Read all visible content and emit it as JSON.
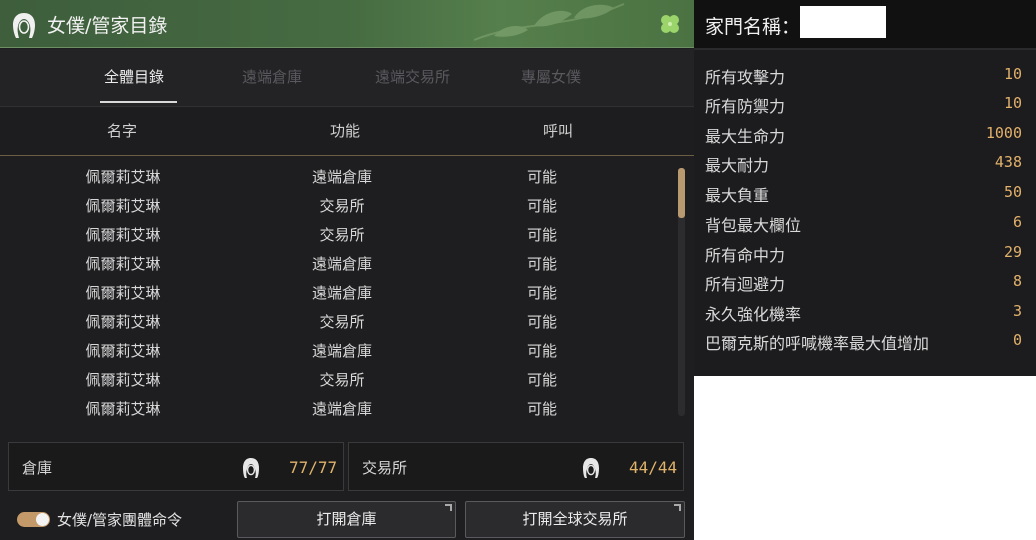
{
  "window": {
    "title": "女僕/管家目錄"
  },
  "tabs": [
    {
      "label": "全體目錄",
      "active": true
    },
    {
      "label": "遠端倉庫",
      "active": false
    },
    {
      "label": "遠端交易所",
      "active": false
    },
    {
      "label": "專屬女僕",
      "active": false
    }
  ],
  "table": {
    "headers": [
      "名字",
      "功能",
      "呼叫"
    ],
    "rows": [
      [
        "佩爾莉艾琳",
        "遠端倉庫",
        "可能"
      ],
      [
        "佩爾莉艾琳",
        "交易所",
        "可能"
      ],
      [
        "佩爾莉艾琳",
        "交易所",
        "可能"
      ],
      [
        "佩爾莉艾琳",
        "遠端倉庫",
        "可能"
      ],
      [
        "佩爾莉艾琳",
        "遠端倉庫",
        "可能"
      ],
      [
        "佩爾莉艾琳",
        "交易所",
        "可能"
      ],
      [
        "佩爾莉艾琳",
        "遠端倉庫",
        "可能"
      ],
      [
        "佩爾莉艾琳",
        "交易所",
        "可能"
      ],
      [
        "佩爾莉艾琳",
        "遠端倉庫",
        "可能"
      ]
    ]
  },
  "counts": {
    "warehouse": {
      "label": "倉庫",
      "value": "77/77"
    },
    "market": {
      "label": "交易所",
      "value": "44/44"
    }
  },
  "footer": {
    "toggle_label": "女僕/管家團體命令",
    "open_warehouse_label": "打開倉庫",
    "open_market_label": "打開全球交易所"
  },
  "family": {
    "label": "家門名稱：",
    "stats": [
      {
        "name": "所有攻擊力",
        "value": "10"
      },
      {
        "name": "所有防禦力",
        "value": "10"
      },
      {
        "name": "最大生命力",
        "value": "1000"
      },
      {
        "name": "最大耐力",
        "value": "438"
      },
      {
        "name": "最大負重",
        "value": "50"
      },
      {
        "name": "背包最大欄位",
        "value": "6"
      },
      {
        "name": "所有命中力",
        "value": "29"
      },
      {
        "name": "所有迴避力",
        "value": "8"
      },
      {
        "name": "永久強化機率",
        "value": "3"
      },
      {
        "name": "巴爾克斯的呼喊機率最大值增加",
        "value": "0"
      }
    ]
  },
  "colors": {
    "accent": "#e2b16b",
    "header_green": "#466b42"
  },
  "icons": [
    "maid-icon",
    "clover-icon",
    "external-link-icon"
  ]
}
